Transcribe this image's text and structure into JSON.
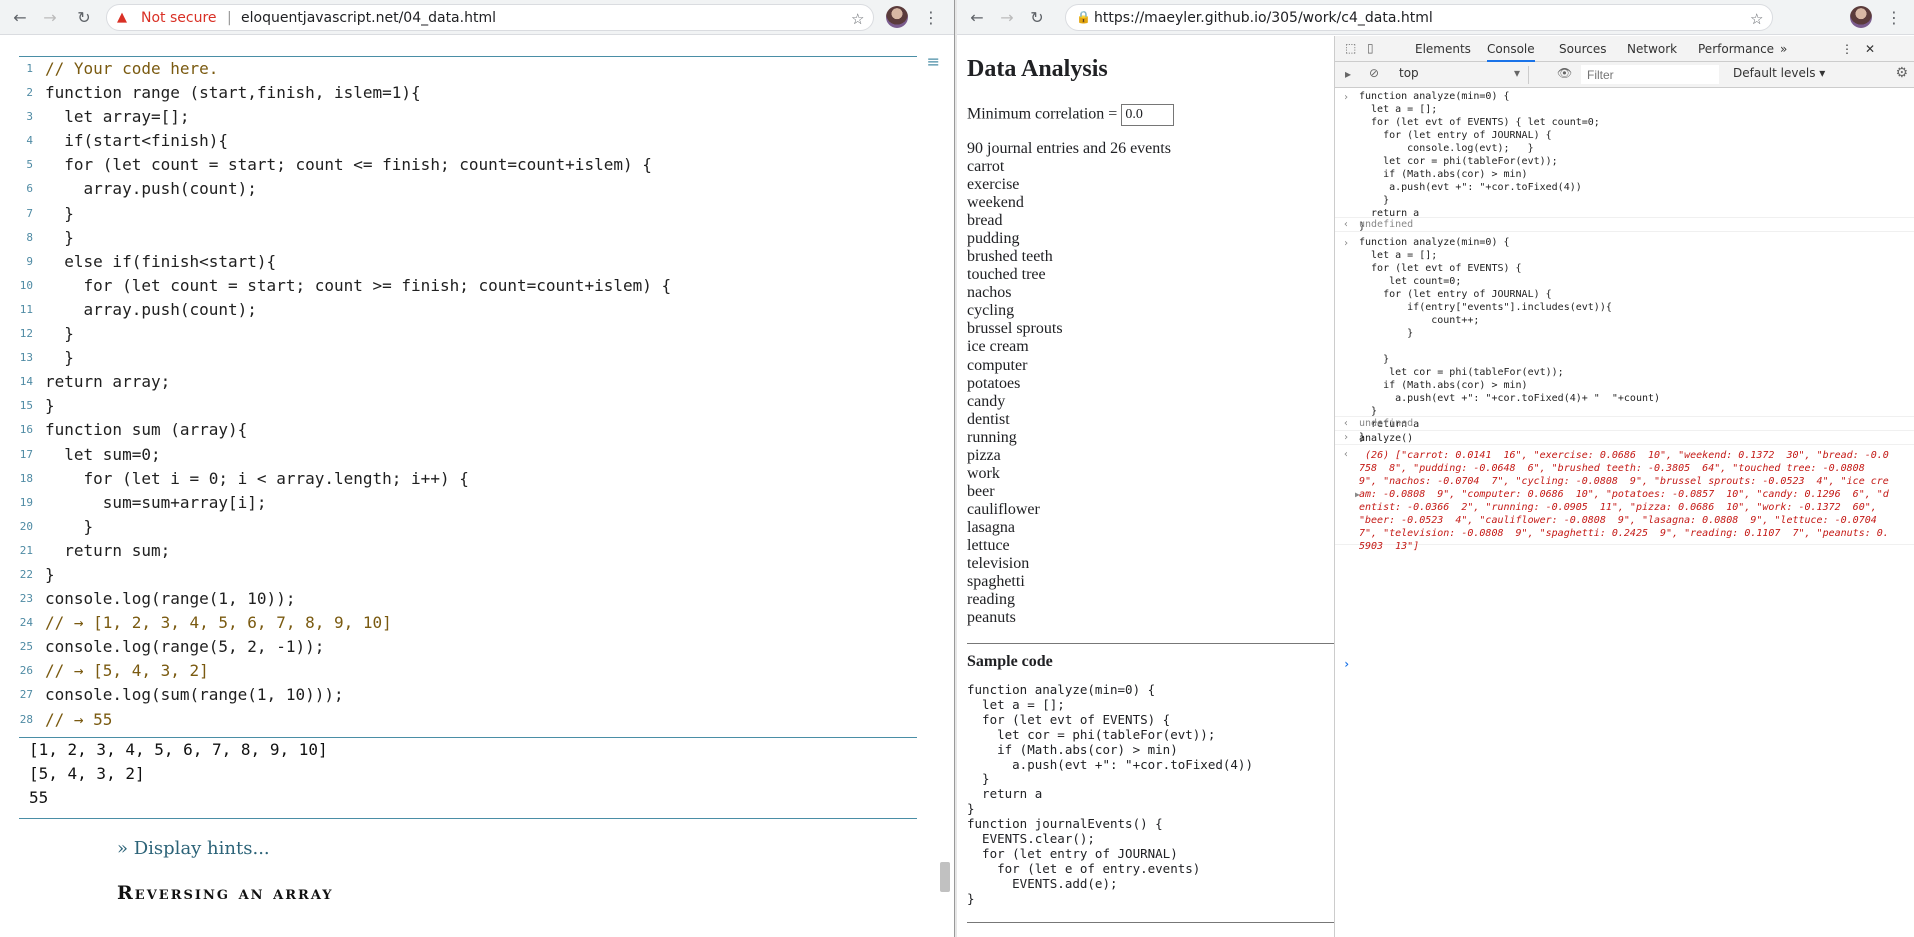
{
  "left": {
    "url_warning": "Not secure",
    "url": "eloquentjavascript.net/04_data.html",
    "code_lines": [
      {
        "n": "1",
        "text": "// Your code here."
      },
      {
        "n": "2",
        "text": "function range (start,finish, islem=1){"
      },
      {
        "n": "3",
        "text": "  let array=[];"
      },
      {
        "n": "4",
        "text": "  if(start<finish){"
      },
      {
        "n": "5",
        "text": "  for (let count = start; count <= finish; count=count+islem) {"
      },
      {
        "n": "6",
        "text": "    array.push(count);"
      },
      {
        "n": "7",
        "text": "  }"
      },
      {
        "n": "8",
        "text": "  }"
      },
      {
        "n": "9",
        "text": "  else if(finish<start){"
      },
      {
        "n": "10",
        "text": "    for (let count = start; count >= finish; count=count+islem) {"
      },
      {
        "n": "11",
        "text": "    array.push(count);"
      },
      {
        "n": "12",
        "text": "  }"
      },
      {
        "n": "13",
        "text": "  }"
      },
      {
        "n": "14",
        "text": "return array;"
      },
      {
        "n": "15",
        "text": "}"
      },
      {
        "n": "16",
        "text": "function sum (array){"
      },
      {
        "n": "17",
        "text": "  let sum=0;"
      },
      {
        "n": "18",
        "text": "    for (let i = 0; i < array.length; i++) {"
      },
      {
        "n": "19",
        "text": "      sum=sum+array[i];"
      },
      {
        "n": "20",
        "text": "    }"
      },
      {
        "n": "21",
        "text": "  return sum;"
      },
      {
        "n": "22",
        "text": "}"
      },
      {
        "n": "23",
        "text": "console.log(range(1, 10));"
      },
      {
        "n": "24",
        "text": "// → [1, 2, 3, 4, 5, 6, 7, 8, 9, 10]"
      },
      {
        "n": "25",
        "text": "console.log(range(5, 2, -1));"
      },
      {
        "n": "26",
        "text": "// → [5, 4, 3, 2]"
      },
      {
        "n": "27",
        "text": "console.log(sum(range(1, 10)));"
      },
      {
        "n": "28",
        "text": "// → 55"
      }
    ],
    "output_lines": [
      "[1, 2, 3, 4, 5, 6, 7, 8, 9, 10]",
      "[5, 4, 3, 2]",
      "55"
    ],
    "hint_link": "» Display hints...",
    "section_title": "Reversing an array"
  },
  "right": {
    "url": "https://maeyler.github.io/305/work/c4_data.html",
    "page_title": "Data Analysis",
    "min_label": "Minimum correlation = ",
    "min_value": "0.0",
    "summary": "90 journal entries and 26 events",
    "events": [
      "carrot",
      "exercise",
      "weekend",
      "bread",
      "pudding",
      "brushed teeth",
      "touched tree",
      "nachos",
      "cycling",
      "brussel sprouts",
      "ice cream",
      "computer",
      "potatoes",
      "candy",
      "dentist",
      "running",
      "pizza",
      "work",
      "beer",
      "cauliflower",
      "lasagna",
      "lettuce",
      "television",
      "spaghetti",
      "reading",
      "peanuts"
    ],
    "sample_heading": "Sample code",
    "sample_code": "function analyze(min=0) {\n  let a = [];\n  for (let evt of EVENTS) {\n    let cor = phi(tableFor(evt));\n    if (Math.abs(cor) > min)\n      a.push(evt +\": \"+cor.toFixed(4))\n  }\n  return a\n}\nfunction journalEvents() {\n  EVENTS.clear();\n  for (let entry of JOURNAL)\n    for (let e of entry.events)\n      EVENTS.add(e);\n}"
  },
  "devtools": {
    "tabs": [
      "Elements",
      "Console",
      "Sources",
      "Network",
      "Performance"
    ],
    "active_tab": "Console",
    "context": "top",
    "filter_placeholder": "Filter",
    "levels": "Default levels",
    "entry1": "function analyze(min=0) {\n  let a = [];\n  for (let evt of EVENTS) { let count=0;\n    for (let entry of JOURNAL) {\n        console.log(evt);   }\n    let cor = phi(tableFor(evt));\n    if (Math.abs(cor) > min)\n     a.push(evt +\": \"+cor.toFixed(4))\n    }\n  return a\n}",
    "undef1": "undefined",
    "entry2": "function analyze(min=0) {\n  let a = [];\n  for (let evt of EVENTS) {\n     let count=0;\n    for (let entry of JOURNAL) {\n        if(entry[\"events\"].includes(evt)){\n            count++;\n        }\n\n    }\n     let cor = phi(tableFor(evt));\n    if (Math.abs(cor) > min)\n      a.push(evt +\": \"+cor.toFixed(4)+ \"  \"+count)\n  }\n  return a\n}",
    "undef2": "undefined",
    "command": "analyze()",
    "result": " (26) [\"carrot: 0.0141  16\", \"exercise: 0.0686  10\", \"weekend: 0.1372  30\", \"bread: -0.0758  8\", \"pudding: -0.0648  6\", \"brushed teeth: -0.3805  64\", \"touched tree: -0.0808  9\", \"nachos: -0.0704  7\", \"cycling: -0.0808  9\", \"brussel sprouts: -0.0523  4\", \"ice cream: -0.0808  9\", \"computer: 0.0686  10\", \"potatoes: -0.0857  10\", \"candy: 0.1296  6\", \"dentist: -0.0366  2\", \"running: -0.0905  11\", \"pizza: 0.0686  10\", \"work: -0.1372  60\", \"beer: -0.0523  4\", \"cauliflower: -0.0808  9\", \"lasagna: 0.0808  9\", \"lettuce: -0.0704  7\", \"television: -0.0808  9\", \"spaghetti: 0.2425  9\", \"reading: 0.1107  7\", \"peanuts: 0.5903  13\"]"
  }
}
